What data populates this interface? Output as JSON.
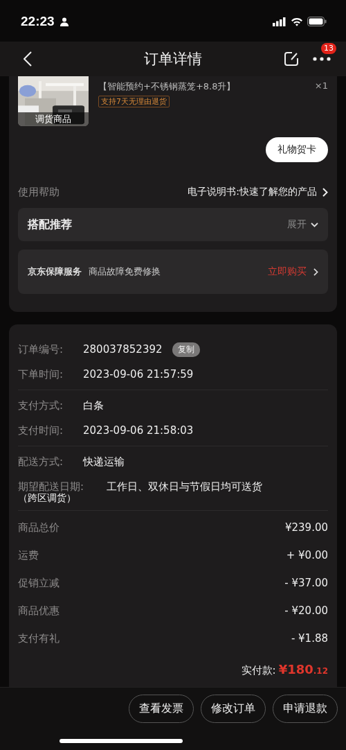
{
  "status_bar": {
    "time": "22:23"
  },
  "nav": {
    "title": "订单详情",
    "badge": "13"
  },
  "product": {
    "spec": "【智能预约+不锈钢蒸笼+8.8升】",
    "quantity": "×1",
    "tag": "支持7天无理由退货",
    "image_label": "调货商品"
  },
  "gift_card_button": "礼物贺卡",
  "help": {
    "label": "使用帮助",
    "link": "电子说明书:快速了解您的产品"
  },
  "recommend": {
    "title": "搭配推荐",
    "toggle": "展开",
    "expanded": false
  },
  "service": {
    "title": "京东保障服务",
    "description": "商品故障免费修换",
    "action": "立即购买"
  },
  "order_info": [
    [
      {
        "label": "订单编号:",
        "value": "280037852392",
        "copy": "复制"
      },
      {
        "label": "下单时间:",
        "value": "2023-09-06 21:57:59"
      }
    ],
    [
      {
        "label": "支付方式:",
        "value": "白条"
      },
      {
        "label": "支付时间:",
        "value": "2023-09-06 21:58:03"
      }
    ],
    [
      {
        "label": "配送方式:",
        "value": "快递运输"
      },
      {
        "label": "期望配送日期:",
        "value": "工作日、双休日与节假日均可送货",
        "note": "（跨区调货）"
      }
    ]
  ],
  "charges": [
    {
      "label": "商品总价",
      "amount": "¥239.00"
    },
    {
      "label": "运费",
      "amount": "+ ¥0.00"
    },
    {
      "label": "促销立减",
      "amount": "- ¥37.00"
    },
    {
      "label": "商品优惠",
      "amount": "- ¥20.00"
    },
    {
      "label": "支付有礼",
      "amount": "- ¥1.88"
    }
  ],
  "total": {
    "label": "实付款:",
    "amount": "¥180",
    "cents": ".12"
  },
  "actions": [
    "查看发票",
    "修改订单",
    "申请退款"
  ]
}
